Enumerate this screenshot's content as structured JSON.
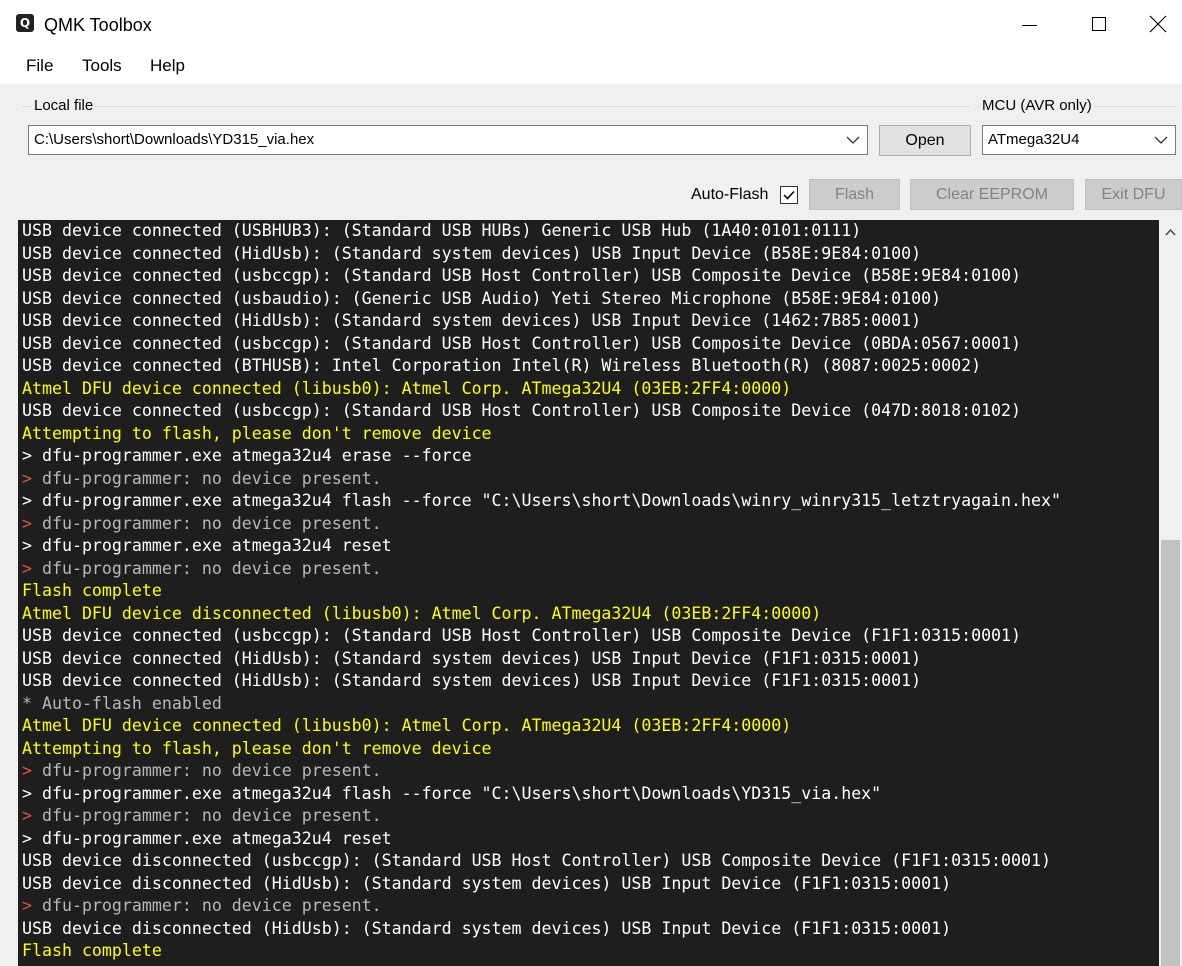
{
  "window": {
    "title": "QMK Toolbox",
    "icon": "qmk-logo-icon"
  },
  "menu": {
    "items": [
      "File",
      "Tools",
      "Help"
    ]
  },
  "local_file": {
    "group_label": "Local file",
    "value": "C:\\Users\\short\\Downloads\\YD315_via.hex",
    "open_label": "Open"
  },
  "mcu": {
    "group_label": "MCU (AVR only)",
    "value": "ATmega32U4"
  },
  "toolbar": {
    "auto_flash_label": "Auto-Flash",
    "auto_flash_checked": true,
    "flash_label": "Flash",
    "clear_eeprom_label": "Clear EEPROM",
    "exit_dfu_label": "Exit DFU"
  },
  "colors": {
    "console_bg": "#1e1e1e",
    "info": "#ffffff",
    "bootloader": "#ffff00",
    "error_arrow": "#e0533a",
    "error_text": "#b8b8b8"
  },
  "console": [
    {
      "type": "info",
      "text": "USB device connected (USBHUB3): (Standard USB HUBs) Generic USB Hub (1A40:0101:0111)"
    },
    {
      "type": "info",
      "text": "USB device connected (HidUsb): (Standard system devices) USB Input Device (B58E:9E84:0100)"
    },
    {
      "type": "info",
      "text": "USB device connected (usbccgp): (Standard USB Host Controller) USB Composite Device (B58E:9E84:0100)"
    },
    {
      "type": "info",
      "text": "USB device connected (usbaudio): (Generic USB Audio) Yeti Stereo Microphone (B58E:9E84:0100)"
    },
    {
      "type": "info",
      "text": "USB device connected (HidUsb): (Standard system devices) USB Input Device (1462:7B85:0001)"
    },
    {
      "type": "info",
      "text": "USB device connected (usbccgp): (Standard USB Host Controller) USB Composite Device (0BDA:0567:0001)"
    },
    {
      "type": "info",
      "text": "USB device connected (BTHUSB): Intel Corporation Intel(R) Wireless Bluetooth(R) (8087:0025:0002)"
    },
    {
      "type": "boot",
      "text": "Atmel DFU device connected (libusb0): Atmel Corp. ATmega32U4 (03EB:2FF4:0000)"
    },
    {
      "type": "info",
      "text": "USB device connected (usbccgp): (Standard USB Host Controller) USB Composite Device (047D:8018:0102)"
    },
    {
      "type": "boot",
      "text": "Attempting to flash, please don't remove device"
    },
    {
      "type": "cmd",
      "text": "> dfu-programmer.exe atmega32u4 erase --force"
    },
    {
      "type": "err",
      "text": "dfu-programmer: no device present."
    },
    {
      "type": "cmd",
      "text": "> dfu-programmer.exe atmega32u4 flash --force \"C:\\Users\\short\\Downloads\\winry_winry315_letztryagain.hex\""
    },
    {
      "type": "err",
      "text": "dfu-programmer: no device present."
    },
    {
      "type": "cmd",
      "text": "> dfu-programmer.exe atmega32u4 reset"
    },
    {
      "type": "err",
      "text": "dfu-programmer: no device present."
    },
    {
      "type": "boot",
      "text": "Flash complete"
    },
    {
      "type": "boot",
      "text": "Atmel DFU device disconnected (libusb0): Atmel Corp. ATmega32U4 (03EB:2FF4:0000)"
    },
    {
      "type": "info",
      "text": "USB device connected (usbccgp): (Standard USB Host Controller) USB Composite Device (F1F1:0315:0001)"
    },
    {
      "type": "info",
      "text": "USB device connected (HidUsb): (Standard system devices) USB Input Device (F1F1:0315:0001)"
    },
    {
      "type": "info",
      "text": "USB device connected (HidUsb): (Standard system devices) USB Input Device (F1F1:0315:0001)"
    },
    {
      "type": "note",
      "text": "* Auto-flash enabled"
    },
    {
      "type": "boot",
      "text": "Atmel DFU device connected (libusb0): Atmel Corp. ATmega32U4 (03EB:2FF4:0000)"
    },
    {
      "type": "boot",
      "text": "Attempting to flash, please don't remove device"
    },
    {
      "type": "err",
      "text": "dfu-programmer: no device present."
    },
    {
      "type": "cmd",
      "text": "> dfu-programmer.exe atmega32u4 flash --force \"C:\\Users\\short\\Downloads\\YD315_via.hex\""
    },
    {
      "type": "err",
      "text": "dfu-programmer: no device present."
    },
    {
      "type": "cmd",
      "text": "> dfu-programmer.exe atmega32u4 reset"
    },
    {
      "type": "info",
      "text": "USB device disconnected (usbccgp): (Standard USB Host Controller) USB Composite Device (F1F1:0315:0001)"
    },
    {
      "type": "info",
      "text": "USB device disconnected (HidUsb): (Standard system devices) USB Input Device (F1F1:0315:0001)"
    },
    {
      "type": "err",
      "text": "dfu-programmer: no device present."
    },
    {
      "type": "info",
      "text": "USB device disconnected (HidUsb): (Standard system devices) USB Input Device (F1F1:0315:0001)"
    },
    {
      "type": "boot",
      "text": "Flash complete"
    }
  ]
}
